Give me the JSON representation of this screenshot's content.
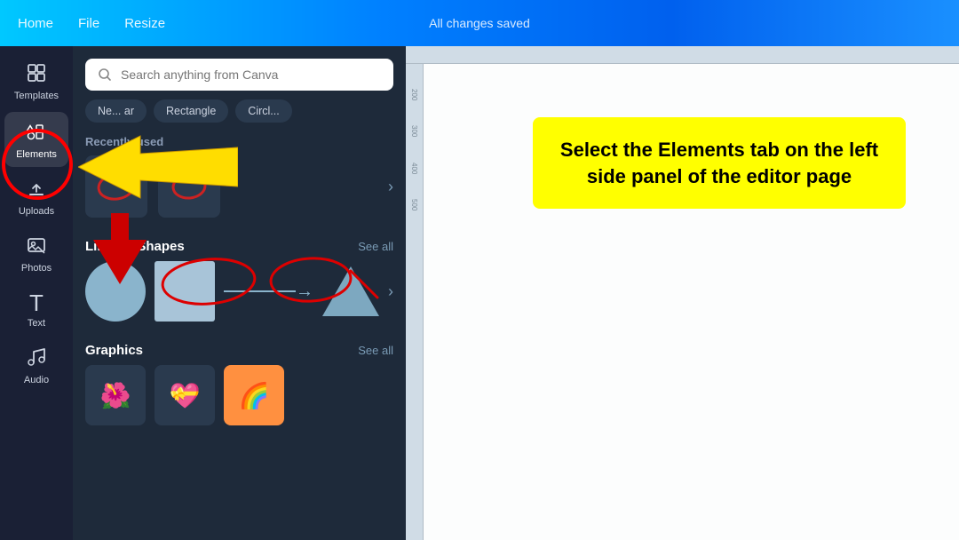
{
  "topbar": {
    "nav_items": [
      "Home",
      "File",
      "Resize"
    ],
    "status": "All changes saved"
  },
  "sidebar": {
    "items": [
      {
        "id": "templates",
        "label": "Templates",
        "icon": "⊞"
      },
      {
        "id": "elements",
        "label": "Elements",
        "icon": "⋄○"
      },
      {
        "id": "uploads",
        "label": "Uploads",
        "icon": "↑"
      },
      {
        "id": "photos",
        "label": "Photos",
        "icon": "🖼"
      },
      {
        "id": "text",
        "label": "Text",
        "icon": "T"
      },
      {
        "id": "audio",
        "label": "Audio",
        "icon": "♪"
      }
    ]
  },
  "panel": {
    "search_placeholder": "Search anything from Canva",
    "filter_chips": [
      "Ne... ar",
      "Rectangle",
      "Circl..."
    ],
    "recently_used_label": "Recently used",
    "sections": [
      {
        "title": "Lines & Shapes",
        "see_all_label": "See all"
      },
      {
        "title": "Graphics",
        "see_all_label": "See all"
      }
    ]
  },
  "tooltip": {
    "text": "Select the Elements tab on the left side panel of the editor page"
  }
}
